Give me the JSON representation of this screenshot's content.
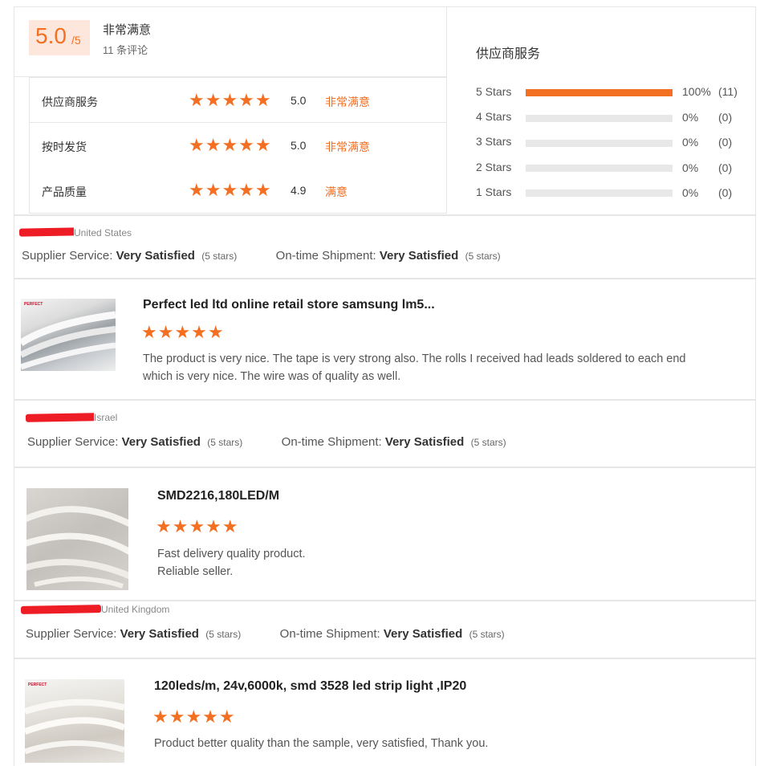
{
  "summary": {
    "score": "5.0",
    "score_suffix": "/5",
    "title": "非常满意",
    "count": "11 条评论",
    "ratings": [
      {
        "label": "供应商服务",
        "stars": "★★★★★",
        "value": "5.0",
        "word": "非常满意"
      },
      {
        "label": "按时发货",
        "stars": "★★★★★",
        "value": "5.0",
        "word": "非常满意"
      },
      {
        "label": "产品质量",
        "stars": "★★★★★",
        "value": "4.9",
        "word": "满意"
      }
    ],
    "distribution_title": "供应商服务",
    "distribution": [
      {
        "label": "5 Stars",
        "fraction": 1.0,
        "pct": "100%",
        "count": "(11)"
      },
      {
        "label": "4 Stars",
        "fraction": 0,
        "pct": "0%",
        "count": "(0)"
      },
      {
        "label": "3 Stars",
        "fraction": 0,
        "pct": "0%",
        "count": "(0)"
      },
      {
        "label": "2 Stars",
        "fraction": 0,
        "pct": "0%",
        "count": "(0)"
      },
      {
        "label": "1 Stars",
        "fraction": 0,
        "pct": "0%",
        "count": "(0)"
      }
    ]
  },
  "reviews": [
    {
      "country": "United States",
      "supplier_label": "Supplier Service:",
      "supplier_value": "Very Satisfied",
      "supplier_stars": "(5 stars)",
      "shipment_label": "On-time Shipment:",
      "shipment_value": "Very Satisfied",
      "shipment_stars": "(5 stars)",
      "brand": "PERFECT",
      "product_title": "Perfect led ltd online retail store samsung lm5...",
      "stars": "★★★★★",
      "text_line1": "The product is very nice.  The tape is very strong also.  The rolls I received had leads soldered to each end",
      "text_line2": "which is very nice.  The wire was of quality as well."
    },
    {
      "country": "Israel",
      "supplier_label": "Supplier Service:",
      "supplier_value": "Very Satisfied",
      "supplier_stars": "(5 stars)",
      "shipment_label": "On-time Shipment:",
      "shipment_value": "Very Satisfied",
      "shipment_stars": "(5 stars)",
      "product_title": "SMD2216,180LED/M",
      "stars": "★★★★★",
      "text_line1": "Fast delivery quality product.",
      "text_line2": "Reliable seller."
    },
    {
      "country": "United Kingdom",
      "supplier_label": "Supplier Service:",
      "supplier_value": "Very Satisfied",
      "supplier_stars": "(5 stars)",
      "shipment_label": "On-time Shipment:",
      "shipment_value": "Very Satisfied",
      "shipment_stars": "(5 stars)",
      "brand": "PERFECT",
      "product_title": "120leds/m, 24v,6000k, smd 3528 led strip light ,IP20",
      "stars": "★★★★★",
      "text_line1": "Product better quality than the sample, very satisfied, Thank you."
    }
  ],
  "colors": {
    "accent": "#f36f21",
    "badge_bg": "#fde7dc",
    "track": "#e8e8e8",
    "redaction": "#ee1c25"
  }
}
